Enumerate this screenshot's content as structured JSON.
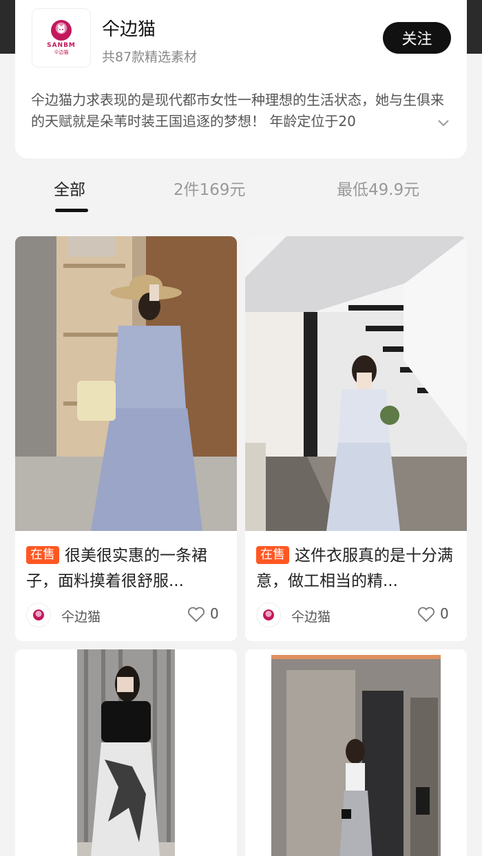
{
  "shop": {
    "logo_text": "SANBM",
    "logo_sub": "仐边猫",
    "name": "仐边猫",
    "count": "共87款精选素材",
    "follow_label": "关注",
    "description": "仐边猫力求表现的是现代都市女性一种理想的生活状态，她与生俱来的天赋就是朵苇时装王国追逐的梦想！ 年龄定位于20"
  },
  "tabs": [
    {
      "label": "全部",
      "active": true
    },
    {
      "label": "2件169元",
      "active": false
    },
    {
      "label": "最低49.9元",
      "active": false
    }
  ],
  "products": [
    {
      "tag": "在售",
      "title": "很美很实惠的一条裙子，面料摸着很舒服...",
      "seller": "仐边猫",
      "likes": "0"
    },
    {
      "tag": "在售",
      "title": "这件衣服真的是十分满意，做工相当的精...",
      "seller": "仐边猫",
      "likes": "0"
    },
    {
      "tag": "",
      "title": "",
      "seller": "",
      "likes": ""
    },
    {
      "tag": "",
      "title": "",
      "seller": "",
      "likes": ""
    }
  ],
  "colors": {
    "accent": "#ff5722",
    "follow_bg": "#111111",
    "page_bg": "#f3f3f3"
  }
}
